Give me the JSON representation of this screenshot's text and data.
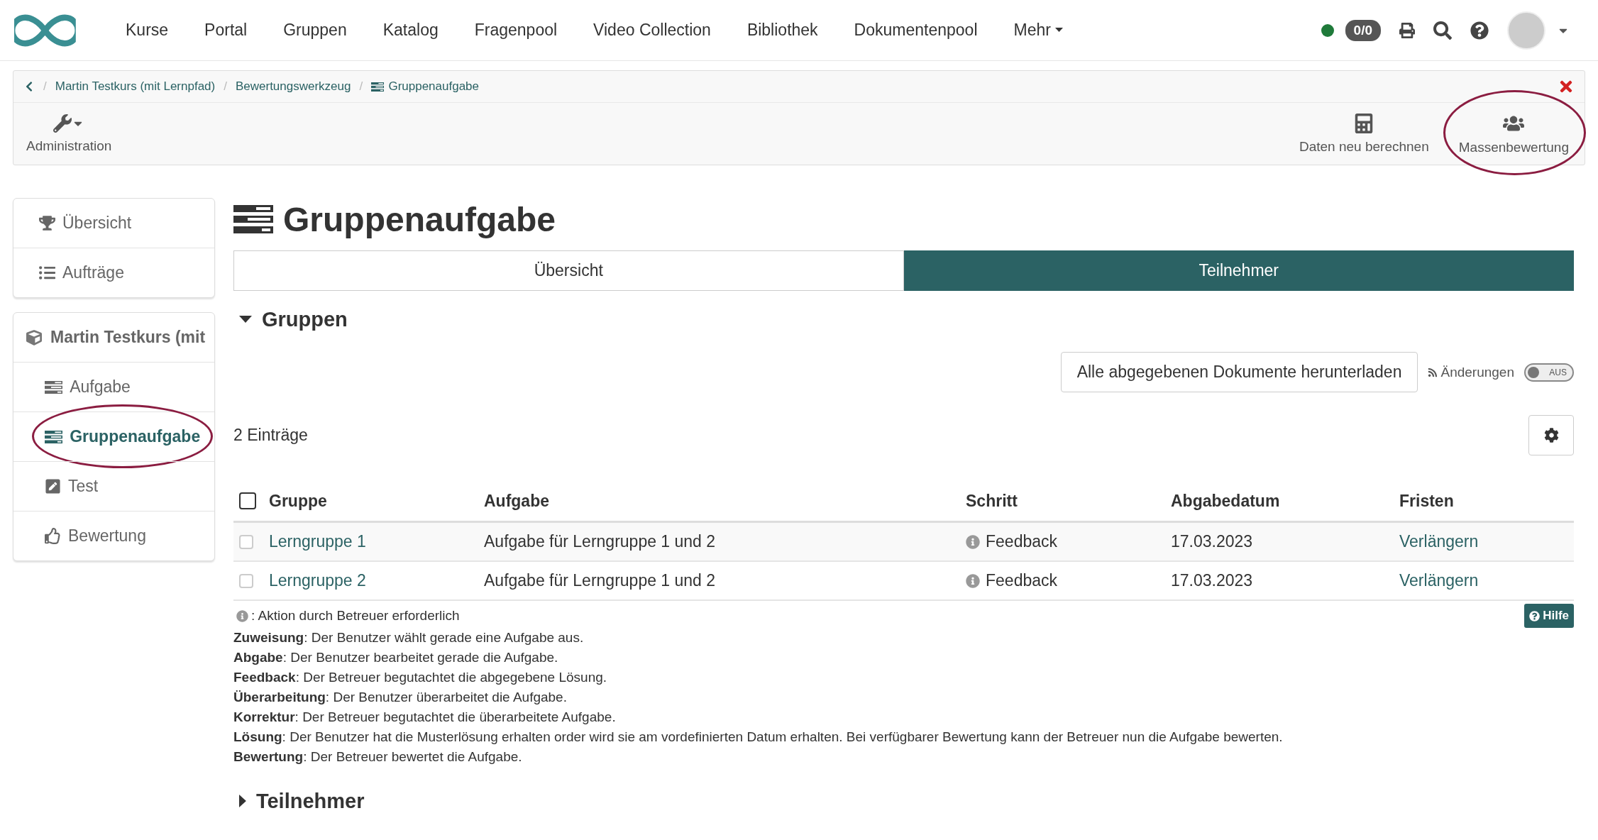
{
  "nav": {
    "items": [
      "Kurse",
      "Portal",
      "Gruppen",
      "Katalog",
      "Fragenpool",
      "Video Collection",
      "Bibliothek",
      "Dokumentenpool"
    ],
    "more": "Mehr",
    "online": true,
    "badge": "0/0"
  },
  "breadcrumb_separator": "/",
  "breadcrumb": [
    "Martin Testkurs (mit Lernpfad)",
    "Bewertungswerkzeug",
    "Gruppenaufgabe"
  ],
  "toolbar": [
    {
      "label": "Administration",
      "kind": "admin",
      "highlighted": false
    },
    {
      "label": "Daten neu berechnen",
      "kind": "calc",
      "highlighted": false
    },
    {
      "label": "Massenbewertung",
      "kind": "group",
      "highlighted": true
    }
  ],
  "sidebar": {
    "items": [
      {
        "label": "Übersicht",
        "kind": "trophy"
      },
      {
        "label": "Aufträge",
        "kind": "list"
      }
    ],
    "course": {
      "title": "Martin Testkurs (mit",
      "items": [
        {
          "label": "Aufgabe",
          "kind": "task",
          "selected": false,
          "highlighted": false
        },
        {
          "label": "Gruppenaufgabe",
          "kind": "task",
          "selected": true,
          "highlighted": true
        },
        {
          "label": "Test",
          "kind": "test",
          "selected": false,
          "highlighted": false
        },
        {
          "label": "Bewertung",
          "kind": "thumb",
          "selected": false,
          "highlighted": false
        }
      ]
    }
  },
  "title": "Gruppenaufgabe",
  "tabs": [
    {
      "label": "Übersicht",
      "selected": false
    },
    {
      "label": "Teilnehmer",
      "selected": true
    }
  ],
  "groups": {
    "title": "Gruppen",
    "expanded": true,
    "download": "Alle abgegebenen Dokumente herunterladen",
    "changes": "Änderungen",
    "toggle": {
      "on": false,
      "label": "AUS"
    },
    "count": "2 Einträge",
    "header_checked": false,
    "columns": [
      "Gruppe",
      "Aufgabe",
      "Schritt",
      "Abgabedatum",
      "Fristen"
    ],
    "rows": [
      {
        "checked": false,
        "group": "Lerngruppe 1",
        "task": "Aufgabe für Lerngruppe 1 und 2",
        "step": "Feedback",
        "date": "17.03.2023",
        "deadline": "Verlängern"
      },
      {
        "checked": false,
        "group": "Lerngruppe 2",
        "task": "Aufgabe für Lerngruppe 1 und 2",
        "step": "Feedback",
        "date": "17.03.2023",
        "deadline": "Verlängern"
      }
    ],
    "note": ": Aktion durch Betreuer erforderlich",
    "help": "Hilfe",
    "legend": [
      "**Zuweisung**: Der Benutzer wählt gerade eine Aufgabe aus.",
      "**Abgabe**: Der Benutzer bearbeitet gerade die Aufgabe.",
      "**Feedback**: Der Betreuer begutachtet die abgegebene Lösung.",
      "**Überarbeitung**: Der Benutzer überarbeitet die Aufgabe.",
      "**Korrektur**: Der Betreuer begutachtet die überarbeitete Aufgabe.",
      "**Lösung**: Der Benutzer hat die Musterlösung erhalten order wird sie am vordefinierten Datum erhalten. Bei verfügbarer Bewertung kann der Betreuer nun die Aufgabe bewerten.",
      "**Bewertung**: Der Betreuer bewertet die Aufgabe."
    ]
  },
  "participants": {
    "title": "Teilnehmer",
    "expanded": false
  }
}
